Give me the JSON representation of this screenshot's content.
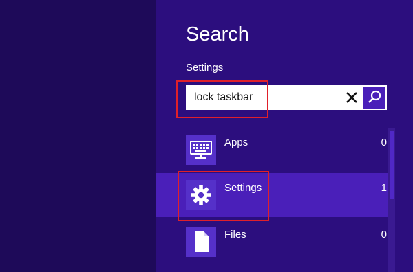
{
  "charm": {
    "title": "Search",
    "scope_label": "Settings"
  },
  "search": {
    "query": "lock taskbar",
    "clear_icon": "close-icon",
    "go_icon": "search-icon"
  },
  "results": [
    {
      "label": "Apps",
      "count": "0",
      "icon": "keyboard-icon",
      "selected": false
    },
    {
      "label": "Settings",
      "count": "1",
      "icon": "gear-icon",
      "selected": true
    },
    {
      "label": "Files",
      "count": "0",
      "icon": "document-icon",
      "selected": false
    }
  ],
  "colors": {
    "background": "#1e0a59",
    "pane": "#2c0e7e",
    "selected_row": "#4a1fb9",
    "tile": "#5530c9",
    "highlight": "#e0202a"
  }
}
